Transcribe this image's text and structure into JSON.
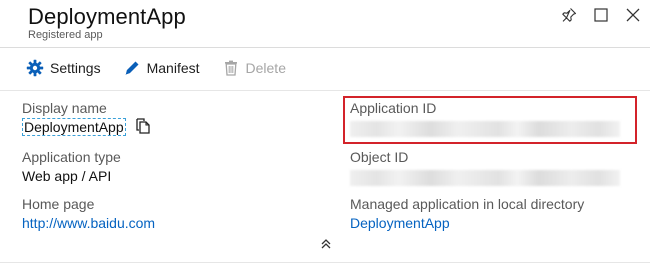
{
  "header": {
    "title": "DeploymentApp",
    "subtitle": "Registered app"
  },
  "toolbar": {
    "settings_label": "Settings",
    "manifest_label": "Manifest",
    "delete_label": "Delete"
  },
  "essentials": {
    "display_name": {
      "label": "Display name",
      "value": "DeploymentApp"
    },
    "application_type": {
      "label": "Application type",
      "value": "Web app / API"
    },
    "home_page": {
      "label": "Home page",
      "value": "http://www.baidu.com"
    },
    "application_id": {
      "label": "Application ID"
    },
    "object_id": {
      "label": "Object ID"
    },
    "managed_app": {
      "label": "Managed application in local directory",
      "value": "DeploymentApp"
    }
  },
  "colors": {
    "accent": "#0563c1",
    "highlight": "#d3232a",
    "icon_blue": "#0a5fb8"
  }
}
